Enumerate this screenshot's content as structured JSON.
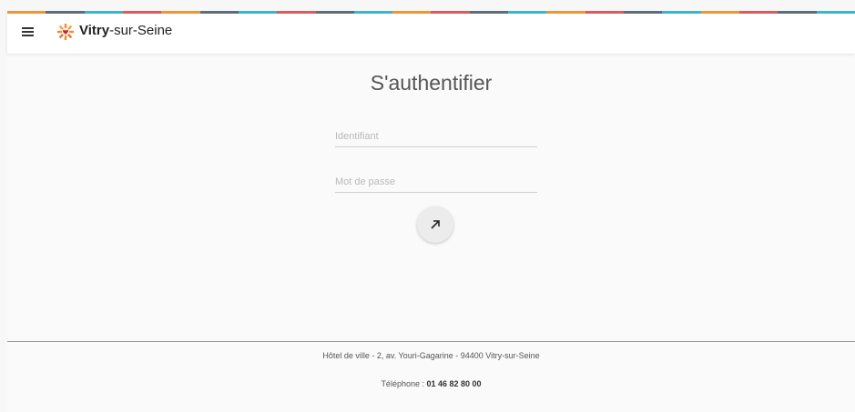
{
  "header": {
    "brand_bold": "Vitry",
    "brand_rest": "-sur-Seine",
    "menu_icon": "hamburger-menu-icon",
    "logo_icon": "city-logo-icon",
    "stripe_colors": [
      "#f0953a",
      "#5b6e7a",
      "#3fb4cf",
      "#e25a5a",
      "#f0953a",
      "#5b6e7a",
      "#3fb4cf",
      "#e25a5a",
      "#5b6e7a",
      "#3fb4cf",
      "#f0953a",
      "#e25a5a",
      "#5b6e7a",
      "#3fb4cf",
      "#f0953a",
      "#e25a5a",
      "#5b6e7a",
      "#3fb4cf",
      "#f0953a",
      "#e25a5a",
      "#5b6e7a",
      "#3fb4cf"
    ]
  },
  "login": {
    "title": "S'authentifier",
    "username_placeholder": "Identifiant",
    "password_placeholder": "Mot de passe",
    "submit_icon": "arrow-up-right-icon"
  },
  "footer": {
    "address": "Hôtel de ville - 2, av. Youri-Gagarine - 94400 Vitry-sur-Seine",
    "phone_label": "Téléphone : ",
    "phone_number": "01 46 82 80 00"
  }
}
